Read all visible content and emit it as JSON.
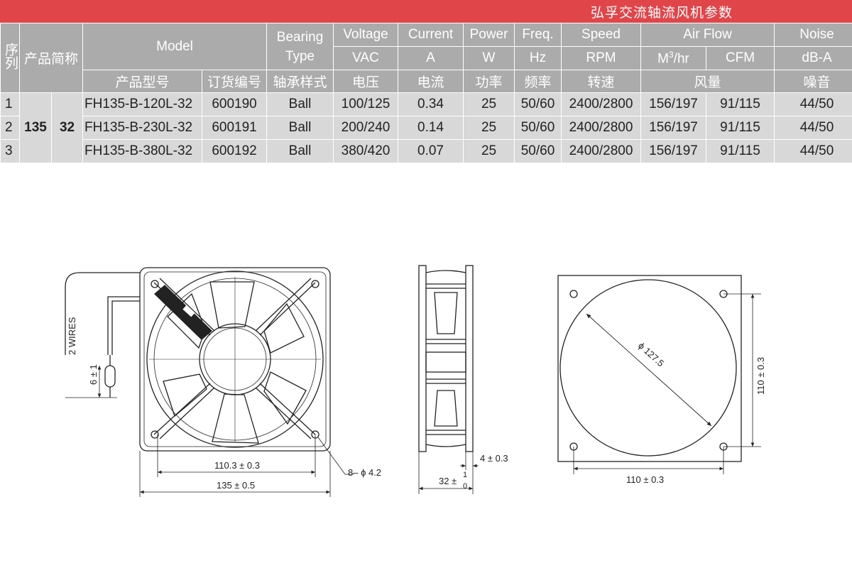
{
  "banner": {
    "title": "弘孚交流轴流风机参数"
  },
  "header": {
    "seq": "序列",
    "short_name": "产品简称",
    "model": "Model",
    "bearing": "Bearing Type",
    "voltage": "Voltage",
    "current": "Current",
    "power": "Power",
    "freq": "Freq.",
    "speed": "Speed",
    "airflow": "Air Flow",
    "noise": "Noise",
    "unit_vac": "VAC",
    "unit_a": "A",
    "unit_w": "W",
    "unit_hz": "Hz",
    "unit_rpm": "RPM",
    "unit_m3hr_base": "M",
    "unit_m3hr_sup": "3",
    "unit_m3hr_tail": "/hr",
    "unit_cfm": "CFM",
    "unit_dba": "dB-A",
    "cn_model": "产品型号",
    "cn_order": "订货编号",
    "cn_bearing": "轴承样式",
    "cn_voltage": "电压",
    "cn_current": "电流",
    "cn_power": "功率",
    "cn_freq": "频率",
    "cn_speed": "转速",
    "cn_airflow": "风量",
    "cn_noise": "噪音"
  },
  "short": {
    "size": "135",
    "depth": "32"
  },
  "rows": [
    {
      "seq": "1",
      "model": "FH135-B-120L-32",
      "order": "600190",
      "bearing": "Ball",
      "voltage": "100/125",
      "current": "0.34",
      "power": "25",
      "freq": "50/60",
      "speed": "2400/2800",
      "m3hr": "156/197",
      "cfm": "91/115",
      "noise": "44/50"
    },
    {
      "seq": "2",
      "model": "FH135-B-230L-32",
      "order": "600191",
      "bearing": "Ball",
      "voltage": "200/240",
      "current": "0.14",
      "power": "25",
      "freq": "50/60",
      "speed": "2400/2800",
      "m3hr": "156/197",
      "cfm": "91/115",
      "noise": "44/50"
    },
    {
      "seq": "3",
      "model": "FH135-B-380L-32",
      "order": "600192",
      "bearing": "Ball",
      "voltage": "380/420",
      "current": "0.07",
      "power": "25",
      "freq": "50/60",
      "speed": "2400/2800",
      "m3hr": "156/197",
      "cfm": "91/115",
      "noise": "44/50"
    }
  ],
  "drawing": {
    "wires": "2 WIRES",
    "wire_len": "6 ± 1",
    "dim_hole_pitch": "110.3 ± 0.3",
    "dim_width": "135 ± 0.5",
    "dim_holes": "8– ϕ 4.2",
    "dim_flange": "4 ± 0.3",
    "dim_depth_base": "32 ±",
    "dim_depth_tol_top": "1",
    "dim_depth_tol_bot": "0",
    "dim_diameter": "ϕ 127.5",
    "dim_back_w": "110 ± 0.3",
    "dim_back_h": "110 ± 0.3"
  }
}
